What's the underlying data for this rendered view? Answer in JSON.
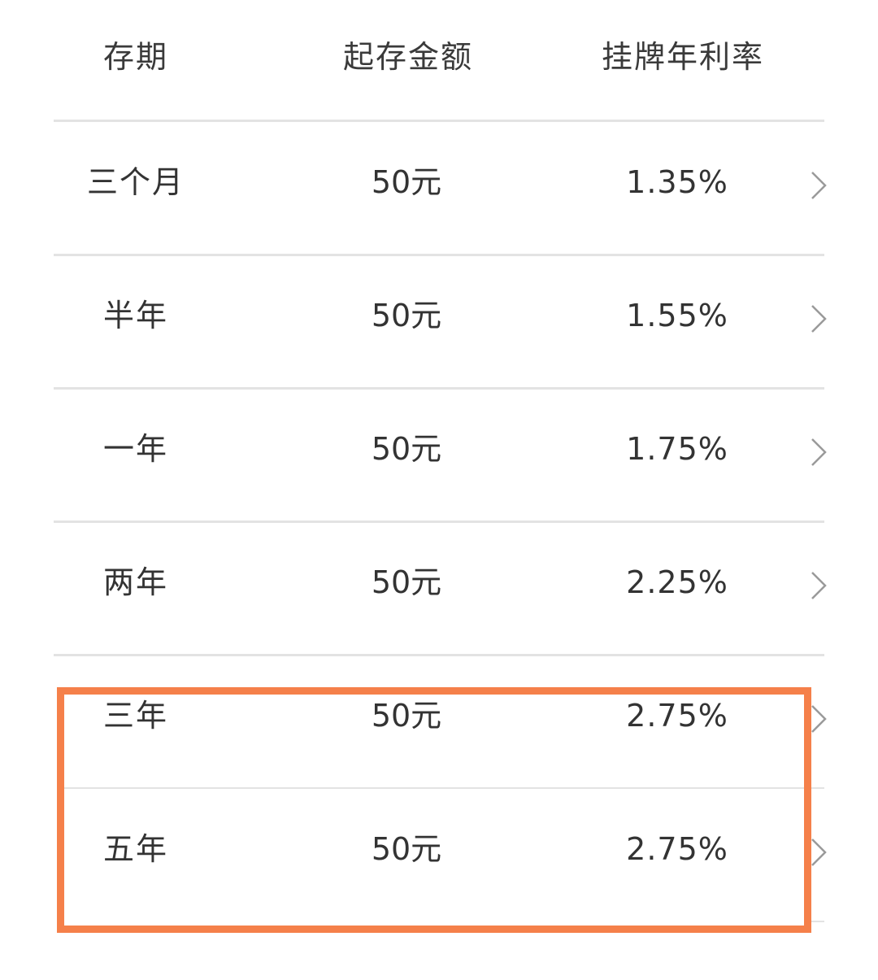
{
  "header": {
    "term_label": "存期",
    "amount_label": "起存金额",
    "rate_label": "挂牌年利率"
  },
  "rows": [
    {
      "term": "三个月",
      "amount": "50元",
      "rate": "1.35%"
    },
    {
      "term": "半年",
      "amount": "50元",
      "rate": "1.55%"
    },
    {
      "term": "一年",
      "amount": "50元",
      "rate": "1.75%"
    },
    {
      "term": "两年",
      "amount": "50元",
      "rate": "2.25%"
    },
    {
      "term": "三年",
      "amount": "50元",
      "rate": "2.75%"
    },
    {
      "term": "五年",
      "amount": "50元",
      "rate": "2.75%"
    }
  ],
  "icons": {
    "row_arrow": "chevron-right-icon"
  },
  "colors": {
    "highlight_border": "#f5804a",
    "divider": "#e3e3e3",
    "text": "#333333",
    "chevron": "#9a9a9a"
  }
}
